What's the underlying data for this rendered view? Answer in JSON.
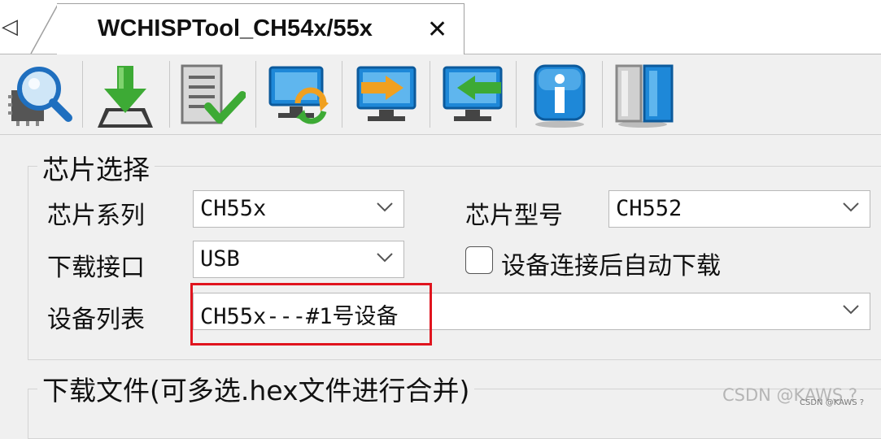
{
  "tab": {
    "title": "WCHISPTool_CH54x/55x",
    "close_glyph": "✕",
    "scroll_left_glyph": "◁"
  },
  "toolbar": {
    "buttons": [
      {
        "icon": "chip-search-icon"
      },
      {
        "icon": "download-icon"
      },
      {
        "icon": "verify-icon"
      },
      {
        "icon": "refresh-device-icon"
      },
      {
        "icon": "export-icon"
      },
      {
        "icon": "import-icon"
      },
      {
        "icon": "info-icon"
      },
      {
        "icon": "panel-toggle-icon"
      }
    ]
  },
  "chip_select": {
    "title": "芯片选择",
    "series_label": "芯片系列",
    "series_value": "CH55x",
    "model_label": "芯片型号",
    "model_value": "CH552",
    "interface_label": "下载接口",
    "interface_value": "USB",
    "auto_download_label": "设备连接后自动下载",
    "auto_download_checked": false,
    "device_list_label": "设备列表",
    "device_list_value": "CH55x---#1号设备"
  },
  "download_file": {
    "title": "下载文件(可多选.hex文件进行合并)"
  },
  "watermark": {
    "main": "CSDN @KAWS ?",
    "small": "CSDN @KAWS ?"
  },
  "colors": {
    "highlight": "#e0141e",
    "icon_blue": "#1e88d8",
    "icon_green": "#3daa35",
    "icon_orange": "#f0a020"
  }
}
